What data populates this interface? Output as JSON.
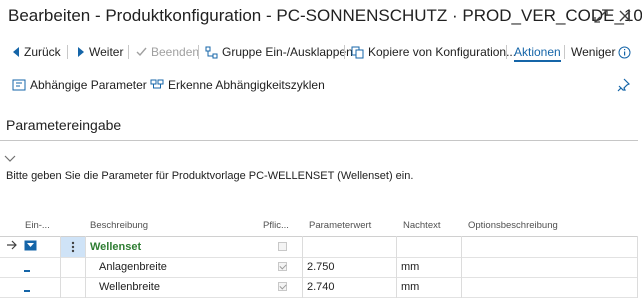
{
  "window": {
    "title": "Bearbeiten - Produktkonfiguration - PC-SONNENSCHUTZ · PROD_VER_CODE_10 · ..."
  },
  "actions": {
    "back": "Zurück",
    "next": "Weiter",
    "finish": "Beenden",
    "group_toggle": "Gruppe Ein-/Ausklappen",
    "copy_config": "Kopiere von Konfiguration...",
    "actions_menu": "Aktionen",
    "less": "Weniger"
  },
  "subactions": {
    "dependent_params": "Abhängige Parameter",
    "detect_cycles": "Erkenne Abhängigkeitszyklen"
  },
  "section": {
    "title": "Parametereingabe",
    "instruction": "Bitte geben Sie die Parameter für Produktvorlage PC-WELLENSET (Wellenset) ein."
  },
  "table": {
    "headers": [
      "Ein-...",
      "Beschreibung",
      "Pflic...",
      "Parameterwert",
      "Nachtext",
      "Optionsbeschreibung"
    ],
    "rows": [
      {
        "description": "Wellenset",
        "required": false,
        "value": "",
        "suffix": "",
        "option": "",
        "group": true
      },
      {
        "description": "Anlagenbreite",
        "required": true,
        "value": "2.750",
        "suffix": "mm",
        "option": "",
        "group": false
      },
      {
        "description": "Wellenbreite",
        "required": true,
        "value": "2.740",
        "suffix": "mm",
        "option": "",
        "group": false
      }
    ]
  },
  "colors": {
    "accent": "#1565a8",
    "selected_cell": "#cfe3f7"
  }
}
